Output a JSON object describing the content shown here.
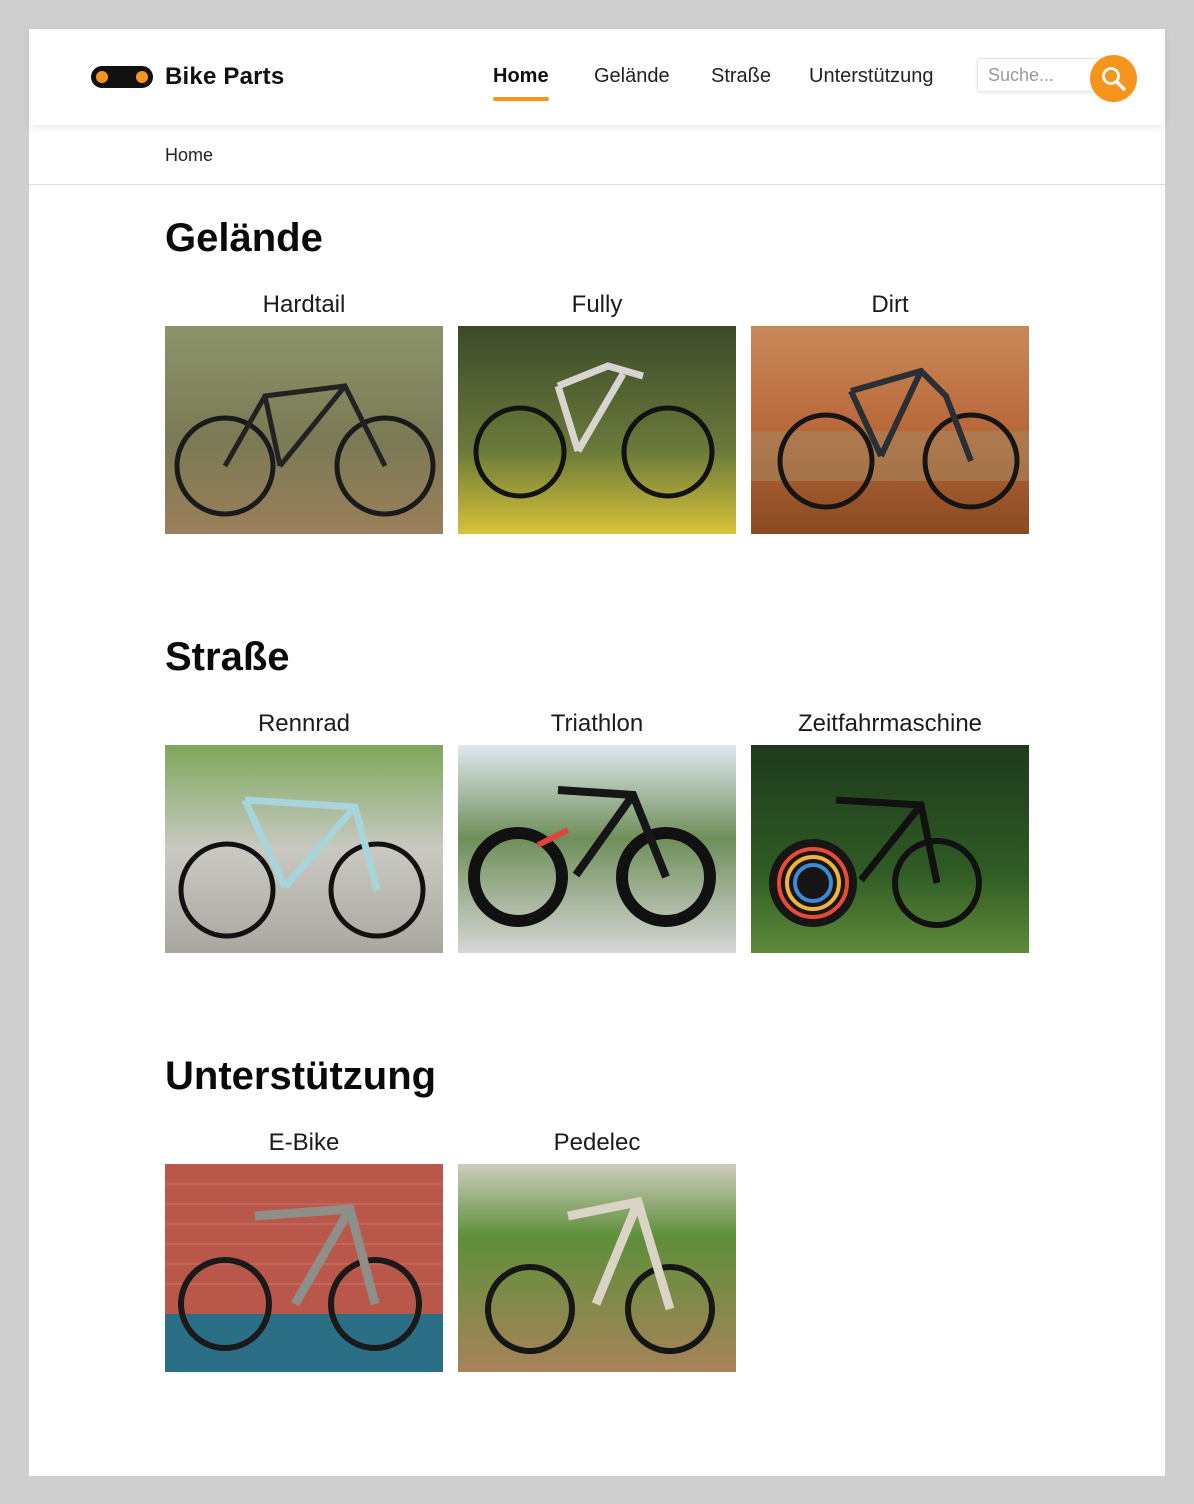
{
  "brand": {
    "name": "Bike Parts",
    "accent": "#f7941d"
  },
  "nav": {
    "items": [
      {
        "label": "Home",
        "active": true
      },
      {
        "label": "Gelände",
        "active": false
      },
      {
        "label": "Straße",
        "active": false
      },
      {
        "label": "Unterstützung",
        "active": false
      }
    ]
  },
  "search": {
    "placeholder": "Suche...",
    "value": "",
    "icon": "search-icon"
  },
  "breadcrumb": {
    "items": [
      "Home"
    ]
  },
  "sections": [
    {
      "title": "Gelände",
      "cards": [
        {
          "label": "Hardtail",
          "image": "bike-photo"
        },
        {
          "label": "Fully",
          "image": "bike-photo"
        },
        {
          "label": "Dirt",
          "image": "bike-photo"
        }
      ]
    },
    {
      "title": "Straße",
      "cards": [
        {
          "label": "Rennrad",
          "image": "bike-photo"
        },
        {
          "label": "Triathlon",
          "image": "bike-photo"
        },
        {
          "label": "Zeitfahrmaschine",
          "image": "bike-photo"
        }
      ]
    },
    {
      "title": "Unterstützung",
      "cards": [
        {
          "label": "E-Bike",
          "image": "bike-photo"
        },
        {
          "label": "Pedelec",
          "image": "bike-photo"
        }
      ]
    }
  ]
}
